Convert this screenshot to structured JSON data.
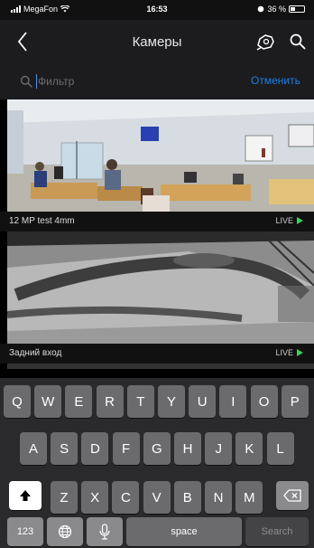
{
  "status_bar": {
    "carrier": "MegaFon",
    "time": "16:53",
    "battery": "36 %",
    "battery_level": 0.36
  },
  "nav": {
    "title": "Камеры",
    "back_icon": "chevron-left-icon",
    "camera_icon": "camera-icon",
    "search_icon": "search-icon"
  },
  "filter": {
    "placeholder": "Фильтр",
    "value": "",
    "cancel_label": "Отменить"
  },
  "cameras": [
    {
      "name": "12 MP test 4mm",
      "live": "LIVE",
      "scene": "office"
    },
    {
      "name": "Задний вход",
      "live": "LIVE",
      "scene": "snowy-yard"
    }
  ],
  "keyboard": {
    "row1": [
      "Q",
      "W",
      "E",
      "R",
      "T",
      "Y",
      "U",
      "I",
      "O",
      "P"
    ],
    "row2": [
      "A",
      "S",
      "D",
      "F",
      "G",
      "H",
      "J",
      "K",
      "L"
    ],
    "row3": [
      "Z",
      "X",
      "C",
      "V",
      "B",
      "N",
      "M"
    ],
    "shift_icon": "shift-icon",
    "delete_icon": "delete-icon",
    "numbers_label": "123",
    "globe_icon": "globe-icon",
    "mic_icon": "microphone-icon",
    "space_label": "space",
    "search_label": "Search"
  },
  "colors": {
    "accent": "#1a7fe4",
    "live": "#3bd15a",
    "nav_bg": "#1c1c1e",
    "keyboard_bg": "#2a2a2c"
  }
}
